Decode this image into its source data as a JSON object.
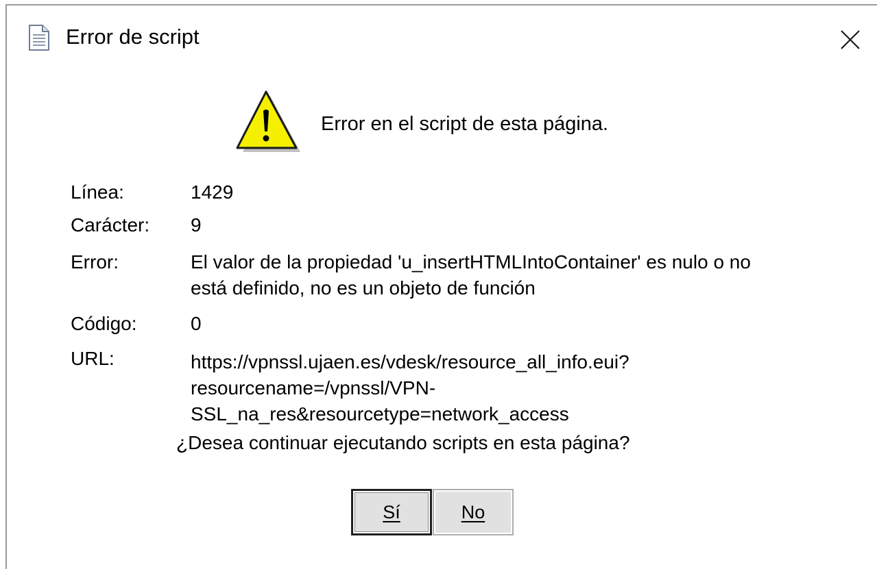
{
  "window": {
    "title": "Error de script",
    "title_icon": "document-icon",
    "close_icon": "close-icon"
  },
  "message": {
    "icon": "warning-icon",
    "headline": "Error en el script de esta página."
  },
  "details": {
    "line_label": "Línea:",
    "line_value": "1429",
    "char_label": "Carácter:",
    "char_value": "9",
    "error_label": "Error:",
    "error_line1": "El valor de la propiedad 'u_insertHTMLIntoContainer' es nulo o no",
    "error_line2": "está definido, no es un objeto de función",
    "code_label": "Código:",
    "code_value": "0",
    "url_label": "URL:",
    "url_line1": "https://vpnssl.ujaen.es/vdesk/resource_all_info.eui?",
    "url_line2": "resourcename=/vpnssl/VPN-",
    "url_line3": "SSL_na_res&resourcetype=network_access"
  },
  "question": "¿Desea continuar ejecutando scripts en esta página?",
  "buttons": {
    "yes": "Sí",
    "no": "No"
  },
  "colors": {
    "warning_yellow": "#f5f000",
    "button_face": "#e1e1e1",
    "default_button_border": "#1f1f1f"
  }
}
